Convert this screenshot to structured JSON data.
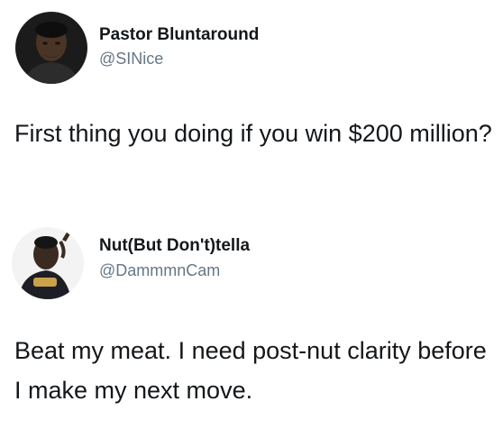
{
  "tweets": [
    {
      "display_name": "Pastor Bluntaround",
      "handle": "@SINice",
      "text": "First thing you doing if you win $200 million?",
      "avatar_icon": "person-avatar-icon"
    },
    {
      "display_name": "Nut(But Don't)tella",
      "handle": "@DammmnCam",
      "text": "Beat my meat. I need post-nut clarity before I make my next move.",
      "avatar_icon": "person-avatar-icon"
    }
  ],
  "colors": {
    "text": "#14171a",
    "handle": "#657786",
    "background": "#ffffff"
  }
}
